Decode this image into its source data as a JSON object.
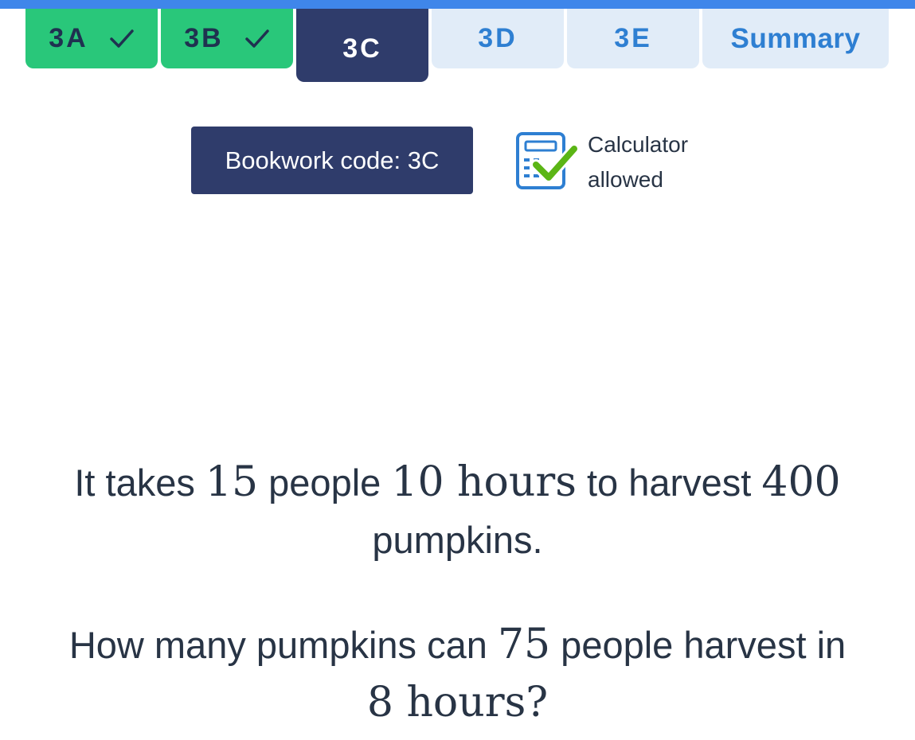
{
  "tabs": [
    {
      "label": "3A",
      "state": "done"
    },
    {
      "label": "3B",
      "state": "done"
    },
    {
      "label": "3C",
      "state": "current"
    },
    {
      "label": "3D",
      "state": "todo"
    },
    {
      "label": "3E",
      "state": "todo"
    },
    {
      "label": "Summary",
      "state": "todo"
    }
  ],
  "bookwork": {
    "label": "Bookwork code: 3C"
  },
  "calculator": {
    "line1": "Calculator",
    "line2": "allowed",
    "icon": "calculator-allowed-icon"
  },
  "question": {
    "line1": {
      "t1": "It takes ",
      "n1": "15",
      "t2": " people ",
      "n2": "10 hours",
      "t3": " to harvest ",
      "n3": "400",
      "t4": "pumpkins."
    },
    "line2": {
      "t1": "How many pumpkins can ",
      "n1": "75",
      "t2": " people harvest in",
      "n2": "8 hours?"
    }
  },
  "colors": {
    "accent": "#3f86ea",
    "done": "#29c77a",
    "current": "#2f3c6b",
    "todo": "#e1ecf8",
    "todo_text": "#2e7fd2",
    "check_green": "#5bb515"
  }
}
